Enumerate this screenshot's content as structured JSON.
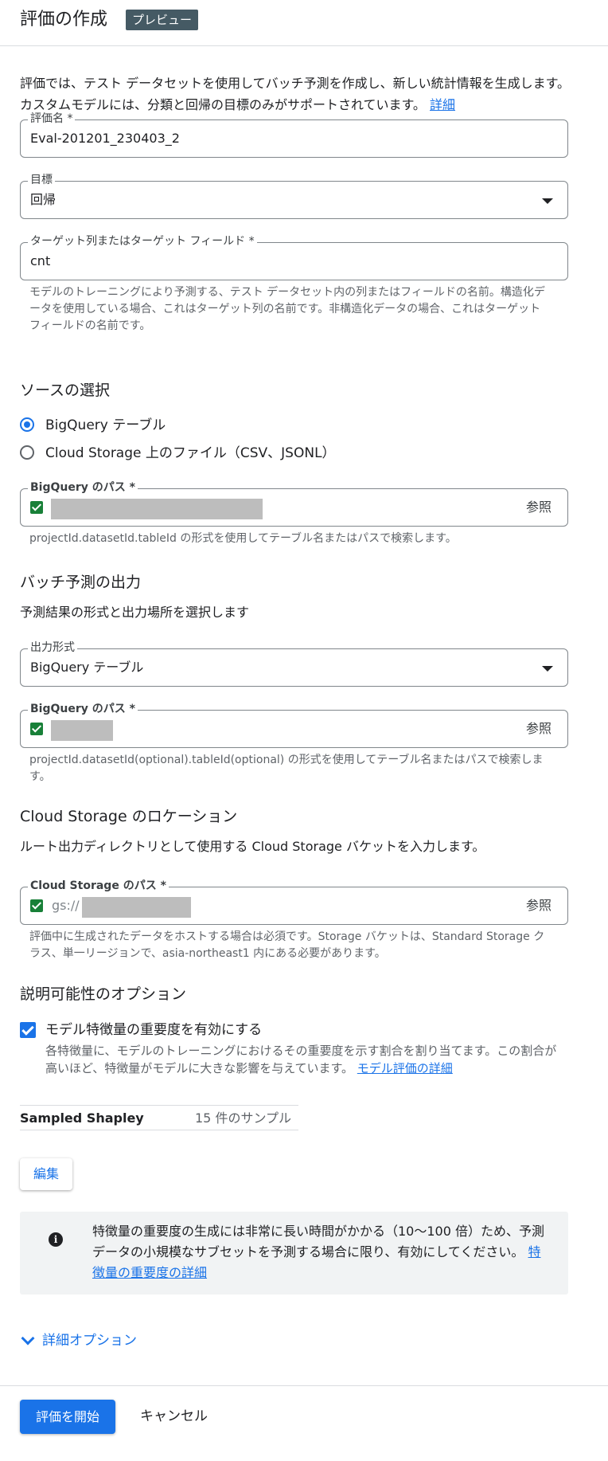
{
  "header": {
    "title": "評価の作成",
    "badge": "プレビュー"
  },
  "intro": {
    "text": "評価では、テスト データセットを使用してバッチ予測を作成し、新しい統計情報を生成します。カスタムモデルには、分類と回帰の目標のみがサポートされています。",
    "link": "詳細"
  },
  "eval_name": {
    "label": "評価名 *",
    "value": "Eval-201201_230403_2"
  },
  "objective": {
    "label": "目標",
    "value": "回帰"
  },
  "target": {
    "label": "ターゲット列またはターゲット フィールド *",
    "value": "cnt",
    "helper": "モデルのトレーニングにより予測する、テスト データセット内の列またはフィールドの名前。構造化データを使用している場合、これはターゲット列の名前です。非構造化データの場合、これはターゲット フィールドの名前です。"
  },
  "source": {
    "title": "ソースの選択",
    "options": [
      {
        "label": "BigQuery テーブル",
        "selected": true
      },
      {
        "label": "Cloud Storage 上のファイル（CSV、JSONL）",
        "selected": false
      }
    ],
    "path_label": "BigQuery のパス *",
    "browse": "参照",
    "helper": "projectId.datasetId.tableId の形式を使用してテーブル名またはパスで検索します。"
  },
  "batch_output": {
    "title": "バッチ予測の出力",
    "subtitle": "予測結果の形式と出力場所を選択します",
    "format_label": "出力形式",
    "format_value": "BigQuery テーブル",
    "path_label": "BigQuery のパス *",
    "browse": "参照",
    "helper": "projectId.datasetId(optional).tableId(optional) の形式を使用してテーブル名またはパスで検索します。"
  },
  "cloud_storage": {
    "title": "Cloud Storage のロケーション",
    "subtitle": "ルート出力ディレクトリとして使用する Cloud Storage バケットを入力します。",
    "path_label": "Cloud Storage のパス *",
    "prefix": "gs://",
    "browse": "参照",
    "helper": "評価中に生成されたデータをホストする場合は必須です。Storage バケットは、Standard Storage クラス、単一リージョンで、asia-northeast1 内にある必要があります。"
  },
  "explainability": {
    "title": "説明可能性のオプション",
    "checkbox_label": "モデル特徴量の重要度を有効にする",
    "checked": true,
    "desc": "各特徴量に、モデルのトレーニングにおけるその重要度を示す割合を割り当てます。この割合が高いほど、特徴量がモデルに大きな影響を与えています。",
    "desc_link": "モデル評価の詳細",
    "method_key": "Sampled Shapley",
    "method_value": "15 件のサンプル",
    "edit": "編集",
    "info_text": "特徴量の重要度の生成には非常に長い時間がかかる（10〜100 倍）ため、予測データの小規模なサブセットを予測する場合に限り、有効にしてください。",
    "info_link": "特徴量の重要度の詳細"
  },
  "advanced": {
    "label": "詳細オプション"
  },
  "footer": {
    "start": "評価を開始",
    "cancel": "キャンセル"
  },
  "colors": {
    "accent": "#1a73e8",
    "badge": "#455a64",
    "success": "#188038"
  }
}
